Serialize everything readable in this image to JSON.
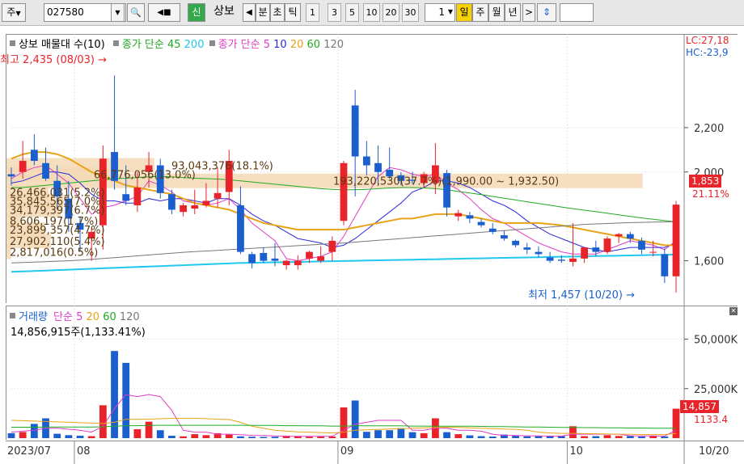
{
  "toolbar": {
    "market": "주",
    "code": "027580",
    "search_glyph": "🔍",
    "sound_glyph": "◀■",
    "credit": "신",
    "name": "상보",
    "prev": "◀",
    "units": [
      "분",
      "초",
      "틱"
    ],
    "periods": [
      "1",
      "3",
      "5",
      "10",
      "20",
      "30"
    ],
    "count": "1",
    "active_period": "일",
    "other_periods": [
      "주",
      "월",
      "년"
    ],
    "next": ">",
    "updown": "⇕"
  },
  "colors": {
    "up": "#e8232a",
    "down": "#1b5fcf",
    "ma5": "#e03cc6",
    "ma10": "#2b2bd9",
    "ma20": "#e8a317",
    "ma60": "#22aa22",
    "ma120": "#777777",
    "ma45": "#22aa22",
    "ma200": "#21c8f0",
    "profile": "#f5d9b6",
    "profile_text": "#5a3a10"
  },
  "legend": {
    "main_name": "상보 매물대 수(10)",
    "avg_long": "종가 단순 45",
    "avg_long_2": "200",
    "avg_short": "종가 단순 5",
    "avg_short_vals": [
      "10",
      "20",
      "60",
      "120"
    ],
    "volume": "거래량",
    "volume_avg": "단순 5",
    "volume_avg_vals": [
      "20",
      "60",
      "120"
    ],
    "volume_latest": "14,856,915주(1,133.41%)"
  },
  "annotations": {
    "high": "최고 2,435 (08/03)",
    "low": "최저 1,457 (10/20)",
    "lc": "LC:27,18",
    "hc": "HC:-23,9",
    "last_price": "1,853",
    "last_pct": "21.11%",
    "last_volume": "14,857",
    "last_volume_pct": "1133.4",
    "high_arrow": "→",
    "low_arrow": "→"
  },
  "chart_data": {
    "type": "candlestick",
    "x": [
      "07/24",
      "07/25",
      "07/26",
      "07/27",
      "07/28",
      "07/31",
      "08/01",
      "08/02",
      "08/03",
      "08/04",
      "08/07",
      "08/08",
      "08/09",
      "08/10",
      "08/11",
      "08/14",
      "08/16",
      "08/17",
      "08/18",
      "08/21",
      "08/22",
      "08/23",
      "08/24",
      "08/25",
      "08/28",
      "08/29",
      "08/30",
      "08/31",
      "09/01",
      "09/04",
      "09/05",
      "09/06",
      "09/07",
      "09/08",
      "09/11",
      "09/12",
      "09/13",
      "09/14",
      "09/15",
      "09/18",
      "09/19",
      "09/20",
      "09/21",
      "09/22",
      "09/25",
      "09/26",
      "09/27",
      "10/04",
      "10/05",
      "10/06",
      "10/10",
      "10/11",
      "10/12",
      "10/13",
      "10/16",
      "10/17",
      "10/18",
      "10/19",
      "10/20"
    ],
    "open": [
      1990,
      2000,
      2100,
      2040,
      1960,
      1880,
      1770,
      1700,
      1760,
      2090,
      1900,
      1850,
      2000,
      2030,
      1900,
      1820,
      1835,
      1850,
      1880,
      1910,
      1850,
      1630,
      1635,
      1610,
      1580,
      1580,
      1610,
      1600,
      1640,
      1780,
      2300,
      2070,
      2040,
      2010,
      1985,
      1965,
      1950,
      1950,
      1995,
      1800,
      1805,
      1775,
      1745,
      1715,
      1690,
      1660,
      1640,
      1615,
      1605,
      1595,
      1610,
      1660,
      1640,
      1710,
      1720,
      1690,
      1640,
      1630,
      1530
    ],
    "high": [
      2020,
      2140,
      2170,
      2110,
      2030,
      1960,
      1800,
      1750,
      2120,
      2435,
      2030,
      2000,
      2090,
      2060,
      1920,
      1860,
      1920,
      1950,
      2020,
      2100,
      1935,
      1640,
      1660,
      1680,
      1605,
      1625,
      1645,
      1665,
      1710,
      2050,
      2370,
      2140,
      2120,
      2110,
      2000,
      2000,
      2000,
      2130,
      2010,
      1830,
      1820,
      1790,
      1770,
      1735,
      1695,
      1680,
      1665,
      1640,
      1625,
      1770,
      1650,
      1690,
      1710,
      1725,
      1730,
      1705,
      1690,
      1655,
      1870
    ],
    "low": [
      1940,
      1970,
      2030,
      1960,
      1830,
      1730,
      1640,
      1600,
      1650,
      1920,
      1850,
      1820,
      1930,
      1880,
      1810,
      1800,
      1810,
      1840,
      1840,
      1850,
      1630,
      1565,
      1590,
      1575,
      1560,
      1560,
      1590,
      1590,
      1600,
      1760,
      1890,
      1985,
      1940,
      1970,
      1940,
      1945,
      1930,
      1900,
      1800,
      1780,
      1770,
      1750,
      1720,
      1690,
      1660,
      1630,
      1615,
      1590,
      1590,
      1575,
      1590,
      1620,
      1630,
      1680,
      1680,
      1630,
      1620,
      1500,
      1457
    ],
    "close": [
      1980,
      2050,
      2050,
      1970,
      1890,
      1790,
      1740,
      1730,
      2060,
      1960,
      1870,
      1930,
      2030,
      1905,
      1830,
      1850,
      1850,
      1870,
      1905,
      2050,
      1640,
      1590,
      1600,
      1600,
      1600,
      1600,
      1640,
      1620,
      1690,
      2040,
      2070,
      2030,
      2000,
      1980,
      1960,
      1960,
      1990,
      2030,
      1840,
      1815,
      1790,
      1760,
      1730,
      1700,
      1670,
      1650,
      1630,
      1600,
      1600,
      1610,
      1660,
      1640,
      1700,
      1720,
      1700,
      1650,
      1640,
      1530,
      1853
    ],
    "volume": [
      2.5,
      3.1,
      7.2,
      10.0,
      2.2,
      1.5,
      1.2,
      1.0,
      16.6,
      44.0,
      38.0,
      4.5,
      8.3,
      4.0,
      1.2,
      0.9,
      2.0,
      1.5,
      2.5,
      1.8,
      0.9,
      0.7,
      0.6,
      0.7,
      1.2,
      1.0,
      0.7,
      0.8,
      0.8,
      15.5,
      19.0,
      3.2,
      4.0,
      4.0,
      5.0,
      3.0,
      2.5,
      10.0,
      3.0,
      2.0,
      1.4,
      1.0,
      0.8,
      1.8,
      1.2,
      0.9,
      1.0,
      0.9,
      1.0,
      6.0,
      1.0,
      1.0,
      1.5,
      1.1,
      1.0,
      0.8,
      1.2,
      0.8,
      14.857
    ],
    "ma": {
      "5": [
        1970,
        2000,
        2020,
        2030,
        1990,
        1950,
        1880,
        1810,
        1840,
        1850,
        1870,
        1890,
        1960,
        1940,
        1910,
        1870,
        1860,
        1850,
        1860,
        1880,
        1830,
        1770,
        1730,
        1690,
        1610,
        1600,
        1610,
        1620,
        1640,
        1710,
        1800,
        1890,
        1980,
        2020,
        2010,
        1990,
        1980,
        1990,
        1950,
        1920,
        1880,
        1830,
        1790,
        1770,
        1740,
        1710,
        1680,
        1660,
        1640,
        1630,
        1630,
        1630,
        1650,
        1670,
        1690,
        1680,
        1670,
        1650,
        1690
      ],
      "10": [
        1950,
        1960,
        1980,
        2000,
        2000,
        1990,
        1950,
        1900,
        1870,
        1870,
        1860,
        1860,
        1880,
        1870,
        1880,
        1880,
        1870,
        1860,
        1880,
        1880,
        1850,
        1810,
        1780,
        1760,
        1730,
        1700,
        1690,
        1680,
        1660,
        1670,
        1700,
        1740,
        1780,
        1820,
        1860,
        1910,
        1930,
        1960,
        1960,
        1950,
        1930,
        1900,
        1870,
        1850,
        1820,
        1780,
        1750,
        1720,
        1700,
        1680,
        1660,
        1650,
        1640,
        1650,
        1660,
        1660,
        1660,
        1660,
        1680
      ],
      "20": [
        2060,
        2080,
        2090,
        2090,
        2080,
        2060,
        2030,
        2000,
        1980,
        1960,
        1940,
        1930,
        1920,
        1910,
        1900,
        1880,
        1860,
        1850,
        1840,
        1830,
        1810,
        1790,
        1770,
        1760,
        1750,
        1740,
        1740,
        1740,
        1740,
        1740,
        1750,
        1760,
        1770,
        1780,
        1790,
        1790,
        1800,
        1810,
        1810,
        1810,
        1800,
        1790,
        1780,
        1770,
        1770,
        1770,
        1770,
        1765,
        1760,
        1750,
        1740,
        1730,
        1720,
        1710,
        1700,
        1690,
        1680,
        1670,
        1670
      ],
      "60": [
        1930,
        1930,
        1935,
        1940,
        1945,
        1950,
        1955,
        1960,
        1965,
        1970,
        1972,
        1975,
        1978,
        1980,
        1978,
        1975,
        1972,
        1970,
        1968,
        1965,
        1960,
        1955,
        1950,
        1945,
        1940,
        1935,
        1930,
        1925,
        1922,
        1920,
        1920,
        1922,
        1925,
        1928,
        1930,
        1930,
        1928,
        1925,
        1920,
        1912,
        1905,
        1898,
        1890,
        1882,
        1874,
        1866,
        1858,
        1850,
        1842,
        1835,
        1828,
        1821,
        1814,
        1807,
        1800,
        1793,
        1787,
        1781,
        1775
      ],
      "120": [
        1590,
        1592,
        1594,
        1596,
        1598,
        1600,
        1603,
        1606,
        1610,
        1614,
        1618,
        1622,
        1626,
        1630,
        1634,
        1638,
        1641,
        1644,
        1647,
        1650,
        1653,
        1656,
        1659,
        1662,
        1665,
        1668,
        1671,
        1674,
        1677,
        1680,
        1684,
        1688,
        1692,
        1696,
        1700,
        1704,
        1708,
        1712,
        1716,
        1720,
        1724,
        1728,
        1732,
        1736,
        1740,
        1744,
        1748,
        1752,
        1756,
        1760,
        1764,
        1766,
        1768,
        1770,
        1772,
        1773,
        1774,
        1775,
        1776
      ],
      "200": [
        1550,
        1552,
        1554,
        1556,
        1558,
        1560,
        1562,
        1564,
        1566,
        1568,
        1570,
        1572,
        1574,
        1576,
        1578,
        1580,
        1582,
        1584,
        1586,
        1588,
        1590,
        1591,
        1592,
        1593,
        1594,
        1595,
        1596,
        1597,
        1598,
        1599,
        1600,
        1601,
        1602,
        1603,
        1604,
        1605,
        1606,
        1607,
        1608,
        1609,
        1610,
        1611,
        1612,
        1613,
        1614,
        1615,
        1616,
        1617,
        1618,
        1619,
        1620,
        1621,
        1622,
        1623,
        1624,
        1625,
        1626,
        1627,
        1628
      ]
    },
    "vol_ma": {
      "5": [
        3,
        3.5,
        4,
        5,
        5,
        4.5,
        4,
        3,
        6,
        15,
        22,
        21,
        22,
        21,
        14,
        4,
        3,
        3,
        2,
        2,
        1.7,
        1.4,
        1.3,
        1.1,
        0.9,
        0.9,
        0.9,
        0.9,
        0.9,
        4,
        7,
        8,
        9,
        9,
        9,
        4,
        4,
        5,
        5,
        4,
        4,
        3.5,
        2,
        1.4,
        1.3,
        1.2,
        1.1,
        1,
        1,
        2,
        2,
        2,
        2,
        2,
        1.2,
        1.1,
        1.1,
        1,
        4
      ],
      "20": [
        9,
        8.8,
        8.6,
        8.4,
        8.2,
        8,
        7.8,
        7.6,
        7.4,
        8,
        9.5,
        9.5,
        9.6,
        9.8,
        10,
        10,
        10,
        9.8,
        9.6,
        9.4,
        8,
        6,
        5,
        4,
        3.5,
        3.2,
        3,
        2.8,
        2.6,
        3,
        4,
        4.2,
        4.4,
        4.6,
        4.8,
        5,
        5.2,
        5.4,
        5.5,
        5.4,
        5.2,
        5,
        4.8,
        4.6,
        4.4,
        4,
        3,
        2.6,
        2.4,
        2.4,
        2.3,
        2.2,
        2.1,
        2,
        1.9,
        1.8,
        1.8,
        1.8,
        2.4
      ],
      "60": [
        5.5,
        5.5,
        5.5,
        5.6,
        5.6,
        5.6,
        5.6,
        5.6,
        5.7,
        6,
        6.3,
        6.3,
        6.4,
        6.5,
        6.5,
        6.5,
        6.5,
        6.5,
        6.5,
        6.5,
        6.5,
        6.4,
        6.4,
        6.4,
        6.3,
        6.3,
        6.2,
        6.2,
        6.1,
        6.1,
        6.2,
        6.2,
        6.2,
        6.2,
        6.2,
        6.1,
        6.1,
        6,
        6,
        6,
        6,
        5.9,
        5.8,
        5.8,
        5.7,
        5.6,
        5.6,
        5.5,
        5.4,
        5.4,
        5.3,
        5.3,
        5.2,
        5.2,
        5.1,
        5.1,
        5,
        5,
        5
      ]
    },
    "profile": [
      {
        "label": "93,043,376(18.1%)",
        "price": 2030,
        "amount": 93043376
      },
      {
        "label": "66,776,056(13.0%)",
        "price": 1990,
        "amount": 66776056
      },
      {
        "label": "193,220,530(37.7%)(1,990.00 ~ 1,932.50)",
        "price": 1960,
        "amount": 193220530
      },
      {
        "label": "26,466,031(5.2%)",
        "price": 1910,
        "amount": 26466031
      },
      {
        "label": "35,845,565(7.0%)",
        "price": 1870,
        "amount": 35845565
      },
      {
        "label": "34,179,397(6.7%)",
        "price": 1830,
        "amount": 34179397
      },
      {
        "label": "8,606,197(1.7%)",
        "price": 1780,
        "amount": 8606197
      },
      {
        "label": "23,899,357(4.7%)",
        "price": 1740,
        "amount": 23899357
      },
      {
        "label": "27,902,110(5.4%)",
        "price": 1690,
        "amount": 27902110
      },
      {
        "label": "2,817,016(0.5%)",
        "price": 1640,
        "amount": 2817016
      }
    ],
    "y_ticks": [
      "2,200",
      "2,000",
      "1,600"
    ],
    "y_tick_values": [
      2200,
      2000,
      1600
    ],
    "vol_ticks": [
      "50,000K",
      "25,000K"
    ],
    "vol_tick_values": [
      50,
      25
    ],
    "x_labels": [
      "2023/07",
      "08",
      "09",
      "10",
      "10/20"
    ],
    "x_label_index": [
      0,
      6,
      29,
      49,
      58
    ],
    "ylim": [
      1420,
      2520
    ],
    "vol_ylim": [
      0,
      60
    ]
  }
}
